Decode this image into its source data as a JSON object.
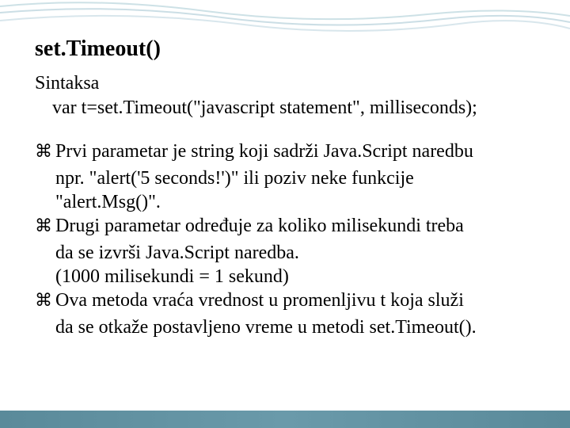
{
  "title": "set.Timeout()",
  "subtitle": "Sintaksa",
  "code_line": "var t=set.Timeout(\"javascript statement\", milliseconds);",
  "bullets": [
    {
      "main": "Prvi parametar je string koji sadrži Java.Script naredbu",
      "lines": [
        "npr. \"alert('5 seconds!')\" ili poziv neke funkcije",
        "\"alert.Msg()\"."
      ]
    },
    {
      "main": "Drugi parametar određuje za koliko milisekundi treba",
      "lines": [
        "da se izvrši Java.Script naredba.",
        "(1000 milisekundi = 1 sekund)"
      ]
    },
    {
      "main": "Ova metoda vraća vrednost u promenljivu t koja služi",
      "lines": [
        "da se otkaže postavljeno vreme u metodi set.Timeout()."
      ]
    }
  ]
}
